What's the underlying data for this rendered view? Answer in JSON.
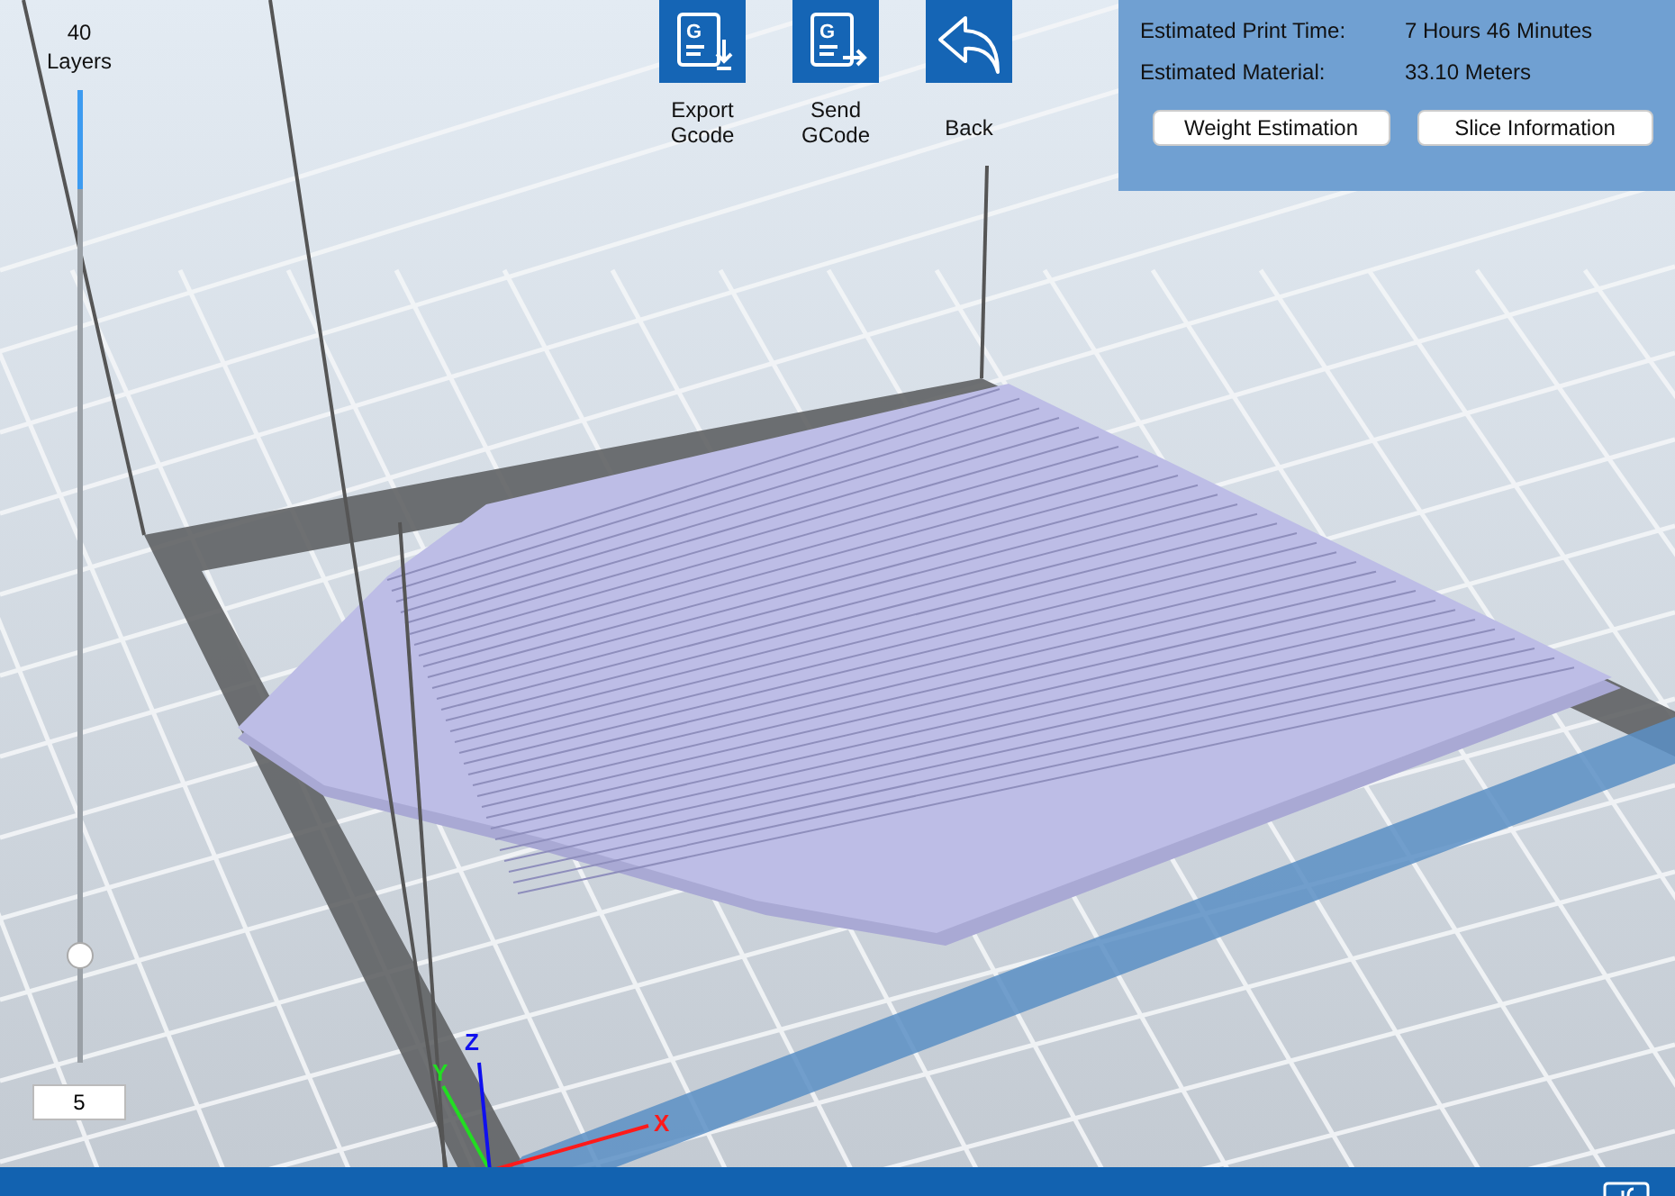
{
  "layer_slider": {
    "count": "40",
    "unit": "Layers",
    "level": 0.11,
    "value": "5"
  },
  "toolbar": [
    {
      "kind": "export",
      "glyph": "G",
      "label": "Export\nGcode"
    },
    {
      "kind": "send",
      "glyph": "G",
      "label": "Send\nGCode"
    },
    {
      "kind": "back",
      "label": "Back"
    }
  ],
  "estimates": [
    {
      "label": "Estimated Print Time:",
      "value": "7 Hours 46 Minutes"
    },
    {
      "label": "Estimated Material:",
      "value": "33.10 Meters"
    }
  ],
  "buttons": [
    "Weight Estimation",
    "Slice Information"
  ],
  "axes": [
    {
      "kind": "x",
      "label": "X"
    },
    {
      "kind": "y",
      "label": "Y"
    },
    {
      "kind": "z",
      "label": "Z"
    }
  ]
}
